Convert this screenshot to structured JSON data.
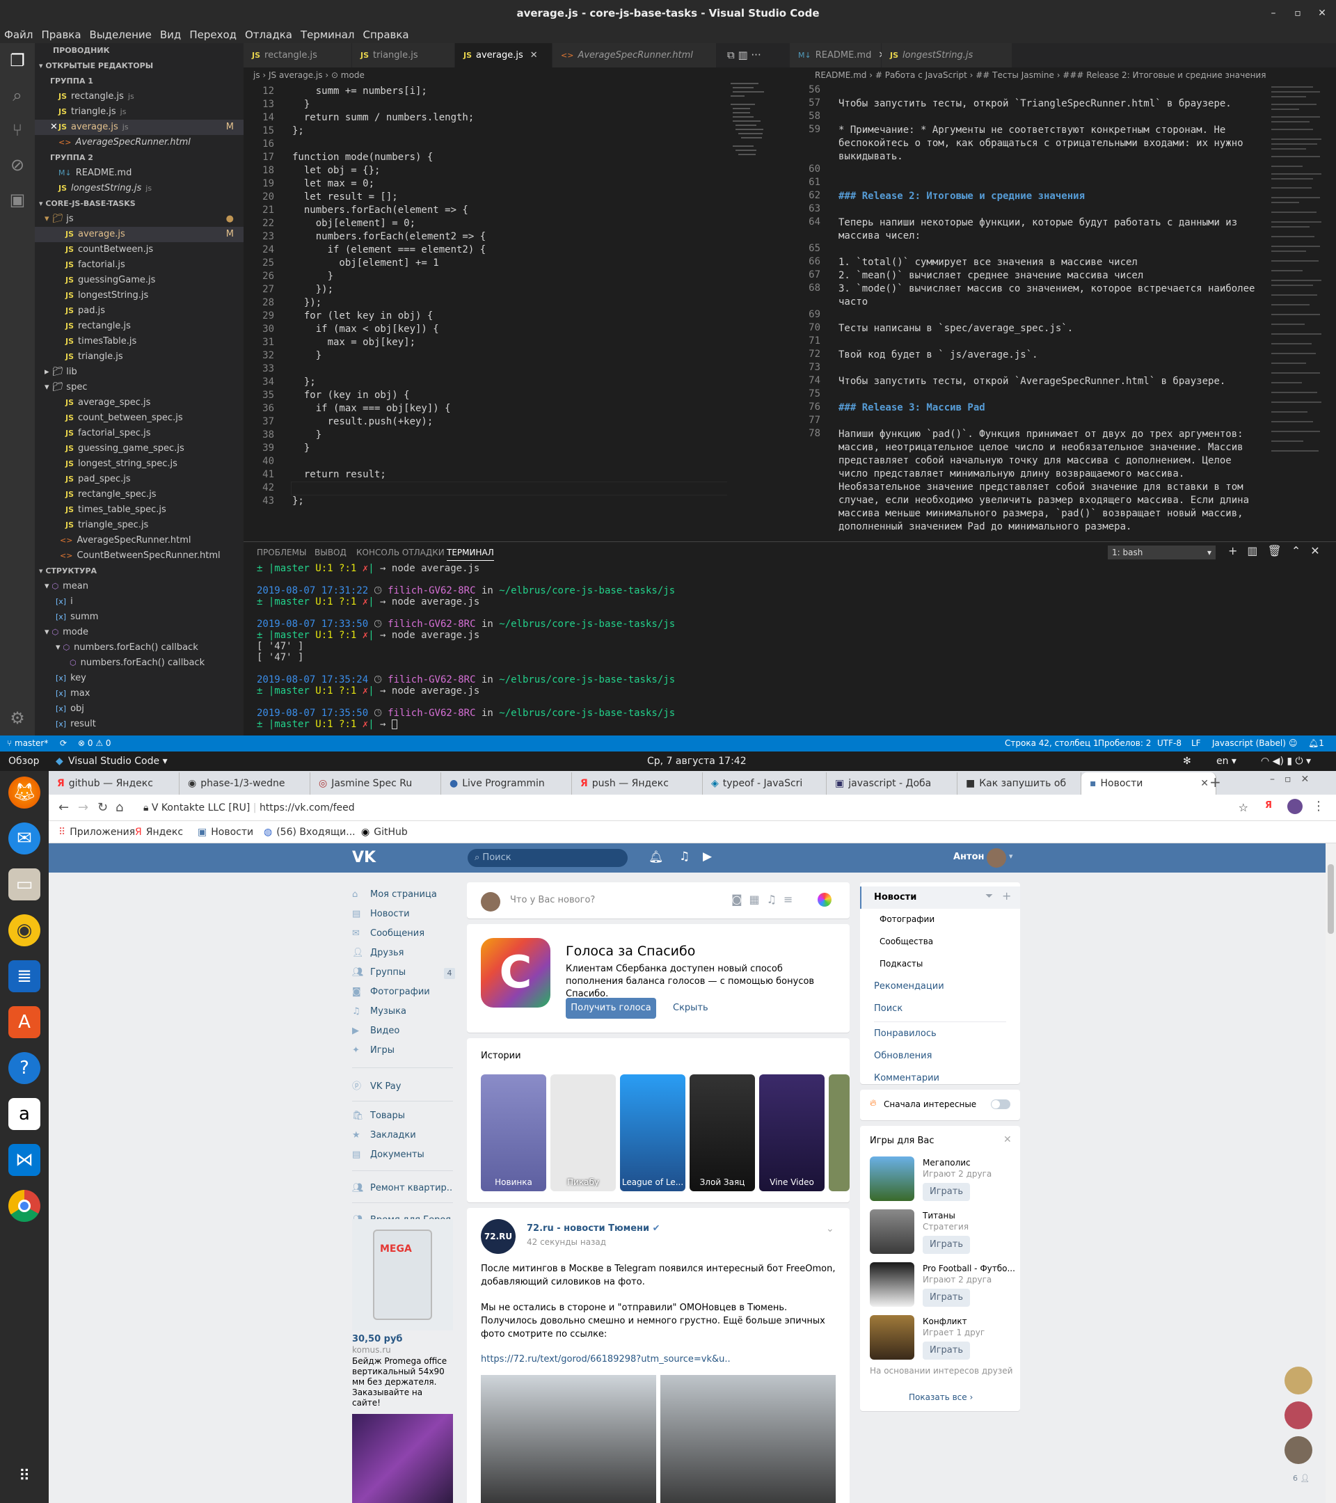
{
  "vscode": {
    "title": "average.js - core-js-base-tasks - Visual Studio Code",
    "menu": [
      "Файл",
      "Правка",
      "Выделение",
      "Вид",
      "Переход",
      "Отладка",
      "Терминал",
      "Справка"
    ],
    "explorer": {
      "header": "ПРОВОДНИК",
      "open_editors": "ОТКРЫТЫЕ РЕДАКТОРЫ",
      "group1": "ГРУППА 1",
      "group1_files": [
        {
          "name": "rectangle.js",
          "dir": "js"
        },
        {
          "name": "triangle.js",
          "dir": "js"
        },
        {
          "name": "average.js",
          "dir": "js",
          "mark": "M"
        },
        {
          "name": "AverageSpecRunner.html",
          "dir": ""
        }
      ],
      "group2": "ГРУППА 2",
      "group2_files": [
        {
          "name": "README.md",
          "dir": ""
        },
        {
          "name": "longestString.js",
          "dir": "js"
        }
      ],
      "project": "CORE-JS-BASE-TASKS",
      "folder_js": "js",
      "js_files": [
        "average.js",
        "countBetween.js",
        "factorial.js",
        "guessingGame.js",
        "longestString.js",
        "pad.js",
        "rectangle.js",
        "timesTable.js",
        "triangle.js"
      ],
      "folder_lib": "lib",
      "folder_spec": "spec",
      "spec_files": [
        "average_spec.js",
        "count_between_spec.js",
        "factorial_spec.js",
        "guessing_game_spec.js",
        "longest_string_spec.js",
        "pad_spec.js",
        "rectangle_spec.js",
        "times_table_spec.js",
        "triangle_spec.js"
      ],
      "root_files": [
        "AverageSpecRunner.html",
        "CountBetweenSpecRunner.html"
      ],
      "outline": "СТРУКТУРА",
      "outline_items": [
        {
          "name": "mean",
          "level": 0,
          "kind": "fn"
        },
        {
          "name": "i",
          "level": 1,
          "kind": "var"
        },
        {
          "name": "summ",
          "level": 1,
          "kind": "var"
        },
        {
          "name": "mode",
          "level": 0,
          "kind": "fn"
        },
        {
          "name": "numbers.forEach() callback",
          "level": 1,
          "kind": "fn"
        },
        {
          "name": "numbers.forEach() callback",
          "level": 2,
          "kind": "fn"
        },
        {
          "name": "key",
          "level": 1,
          "kind": "var"
        },
        {
          "name": "max",
          "level": 1,
          "kind": "var"
        },
        {
          "name": "obj",
          "level": 1,
          "kind": "var"
        },
        {
          "name": "result",
          "level": 1,
          "kind": "var"
        }
      ]
    },
    "tabs_left": [
      "rectangle.js",
      "triangle.js",
      "average.js",
      "AverageSpecRunner.html"
    ],
    "tabs_right": [
      "README.md",
      "longestString.js"
    ],
    "breadcrumb_left": "js › JS average.js › ⊙ mode",
    "breadcrumb_right": "README.md › # Работа с JavaScript › ## Тесты Jasmine › ### Release 2: Итоговые и средние значения",
    "code_start_line": 12,
    "code_lines": [
      "    summ += numbers[i];",
      "  }",
      "  return summ / numbers.length;",
      "};",
      "",
      "function mode(numbers) {",
      "  let obj = {};",
      "  let max = 0;",
      "  let result = [];",
      "  numbers.forEach(element => {",
      "    obj[element] = 0;",
      "    numbers.forEach(element2 => {",
      "      if (element === element2) {",
      "        obj[element] += 1",
      "      }",
      "    });",
      "  });",
      "  for (let key in obj) {",
      "    if (max < obj[key]) {",
      "      max = obj[key];",
      "    }",
      "",
      "  };",
      "  for (key in obj) {",
      "    if (max === obj[key]) {",
      "      result.push(+key);",
      "    }",
      "  }",
      "",
      "  return result;",
      "",
      "};"
    ],
    "md_lines": [
      {
        "n": "56",
        "t": ""
      },
      {
        "n": "57",
        "t": "Чтобы запустить тесты, открой `TriangleSpecRunner.html` в браузере."
      },
      {
        "n": "58",
        "t": ""
      },
      {
        "n": "59",
        "t": "* Примечание: * Аргументы не соответствуют конкретным сторонам. Не беспокойтесь о том, как обращаться с отрицательными входами: их нужно выкидывать."
      },
      {
        "n": "60",
        "t": ""
      },
      {
        "n": "61",
        "t": ""
      },
      {
        "n": "62",
        "t": "### Release 2: Итоговые и средние значения"
      },
      {
        "n": "63",
        "t": ""
      },
      {
        "n": "64",
        "t": "Теперь напиши некоторые функции, которые будут работать с данными из массива чисел:"
      },
      {
        "n": "65",
        "t": ""
      },
      {
        "n": "66",
        "t": "1. `total()` суммирует все значения в массиве чисел"
      },
      {
        "n": "67",
        "t": "2. `mean()` вычисляет среднее значение массива чисел"
      },
      {
        "n": "68",
        "t": "3. `mode()` вычисляет массив со значением, которое встречается наиболее часто"
      },
      {
        "n": "69",
        "t": ""
      },
      {
        "n": "70",
        "t": "Тесты написаны в `spec/average_spec.js`."
      },
      {
        "n": "71",
        "t": ""
      },
      {
        "n": "72",
        "t": "Твой код будет в ` js/average.js`."
      },
      {
        "n": "73",
        "t": ""
      },
      {
        "n": "74",
        "t": "Чтобы запустить тесты, открой `AverageSpecRunner.html` в браузере."
      },
      {
        "n": "75",
        "t": ""
      },
      {
        "n": "76",
        "t": "### Release 3: Массив Pad"
      },
      {
        "n": "77",
        "t": ""
      },
      {
        "n": "78",
        "t": "Напиши функцию `pad()`. Функция принимает от двух до трех аргументов: массив, неотрицательное целое число и необязательное значение. Массив представляет собой начальную точку для массива с дополнением. Целое число представляет минимальную длину возвращаемого массива. Необязательное значение представляет собой значение для вставки в том случае, если необходимо увеличить размер входящего массива. Если длина массива меньше минимального размера, `pad()` возвращает новый массив, дополненный значением Pad до минимального размера."
      }
    ],
    "panel_tabs": [
      "ПРОБЛЕМЫ",
      "ВЫВОД",
      "КОНСОЛЬ ОТЛАДКИ",
      "ТЕРМИНАЛ"
    ],
    "terminal_select": "1: bash",
    "terminal": {
      "prompt": "± |master U:1 ?:1 ✗| → ",
      "cmd": "node average.js",
      "host": "filich-GV62-8RC",
      "path": "~/elbrus/core-js-base-tasks/js",
      "times": [
        "2019-08-07 17:31:22",
        "2019-08-07 17:33:50",
        "2019-08-07 17:35:24",
        "2019-08-07 17:35:50"
      ],
      "output": [
        "[ '47' ]",
        "[ '47' ]"
      ],
      "in": "in"
    },
    "status": {
      "branch": "master*",
      "errors": "0",
      "warnings": "0",
      "position": "Строка 42, столбец 1",
      "spaces": "Пробелов: 2",
      "encoding": "UTF-8",
      "eol": "LF",
      "language": "Javascript (Babel)",
      "notifications": "1"
    }
  },
  "ubuntu": {
    "overview": "Обзор",
    "app": "Visual Studio Code ▾",
    "clock": "Ср, 7 августа  17:42",
    "lang": "en ▾"
  },
  "chrome": {
    "tabs": [
      "github — Яндекс",
      "phase-1/3-wedne",
      "Jasmine Spec Ru",
      "Live Programmin",
      "push — Яндекс",
      "typeof - JavaScri",
      "javascript - Доба",
      "Как запушить об",
      "Новости"
    ],
    "site_id": "V Kontakte LLC [RU]",
    "url": "https://vk.com/feed",
    "bookmarks": [
      "Приложения",
      "Яндекс",
      "Новости",
      "(56) Входящи...",
      "GitHub"
    ]
  },
  "vk": {
    "search_placeholder": "Поиск",
    "user": "Антон",
    "left_menu": [
      "Моя страница",
      "Новости",
      "Сообщения",
      "Друзья",
      "Группы",
      "Фотографии",
      "Музыка",
      "Видео",
      "Игры",
      "VK Pay",
      "Товары",
      "Закладки",
      "Документы",
      "Ремонт квартир..",
      "Время для Героя"
    ],
    "messages_badge": "4",
    "ad": {
      "price": "30,50 руб",
      "site": "komus.ru",
      "text": "Бейдж Promega office вертикальный 54х90 мм без держателя. Заказывайте на сайте!"
    },
    "compose_placeholder": "Что у Вас нового?",
    "promo": {
      "title": "Голоса за Спасибо",
      "text": "Клиентам Сбербанка доступен новый способ пополнения баланса голосов — с помощью бонусов Спасибо.",
      "btn": "Получить голоса",
      "hide": "Скрыть"
    },
    "stories_title": "Истории",
    "stories": [
      "Новинка",
      "Пикабу",
      "League of Le...",
      "Злой Заяц",
      "Vine Video"
    ],
    "post": {
      "author": "72.ru - новости Тюмени",
      "time": "42 секунды назад",
      "p1": "После митингов в Москве в Telegram появился интересный бот FreeOmon, добавляющий силовиков на фото.",
      "p2": "Мы не остались в стороне и \"отправили\" ОМОНовцев в Тюмень. Получилось довольно смешно и немного грустно. Ещё больше эпичных фото смотрите по ссылке:",
      "link": "https://72.ru/text/gorod/66189298?utm_source=vk&u..",
      "avatar": "72.RU"
    },
    "filter": {
      "title": "Новости",
      "items": [
        "Фотографии",
        "Сообщества",
        "Подкасты"
      ],
      "links": [
        "Рекомендации",
        "Поиск"
      ],
      "links2": [
        "Понравилось",
        "Обновления",
        "Комментарии"
      ]
    },
    "interesting": "Сначала интересные",
    "games": {
      "title": "Игры для Вас",
      "items": [
        {
          "name": "Мегаполис",
          "sub": "Играют 2 друга",
          "btn": "Играть"
        },
        {
          "name": "Титаны",
          "sub": "Стратегия",
          "btn": "Играть"
        },
        {
          "name": "Pro Football - Футбо...",
          "sub": "Играют 2 друга",
          "btn": "Играть"
        },
        {
          "name": "Конфликт",
          "sub": "Играет 1 друг",
          "btn": "Играть"
        }
      ],
      "note": "На основании интересов друзей",
      "show_all": "Показать все ›"
    },
    "online_count": "6"
  },
  "colors": {
    "vscode_bg": "#1e1e1e",
    "status": "#007acc",
    "vk_blue": "#4a76a8"
  }
}
